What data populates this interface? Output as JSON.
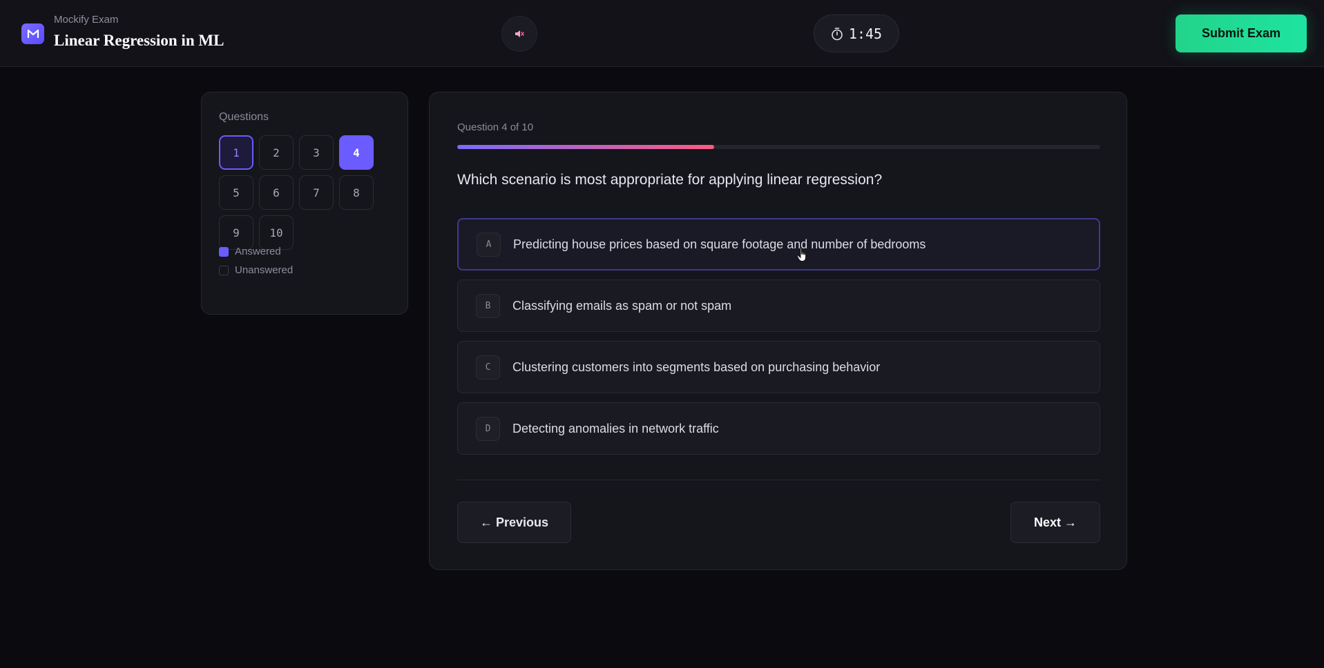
{
  "header": {
    "brand_sub": "Mockify Exam",
    "title": "Linear Regression in ML",
    "timer": "1:45",
    "submit_label": "Submit Exam",
    "icons": {
      "logo": "mockify-logo-icon",
      "sound": "speaker-muted-icon",
      "timer": "stopwatch-icon"
    }
  },
  "navigator": {
    "title": "Questions",
    "questions": [
      {
        "label": "1",
        "state": "current"
      },
      {
        "label": "2",
        "state": "unanswered"
      },
      {
        "label": "3",
        "state": "unanswered"
      },
      {
        "label": "4",
        "state": "answered"
      },
      {
        "label": "5",
        "state": "unanswered"
      },
      {
        "label": "6",
        "state": "unanswered"
      },
      {
        "label": "7",
        "state": "unanswered"
      },
      {
        "label": "8",
        "state": "unanswered"
      },
      {
        "label": "9",
        "state": "unanswered"
      },
      {
        "label": "10",
        "state": "unanswered"
      }
    ],
    "legend": {
      "answered": "Answered",
      "unanswered": "Unanswered"
    }
  },
  "question": {
    "counter": "Question 4 of 10",
    "progress": 0.4,
    "text": "Which scenario is most appropriate for applying linear regression?",
    "options": [
      {
        "letter": "A",
        "text": "Predicting house prices based on square footage and number of bedrooms",
        "selected": true
      },
      {
        "letter": "B",
        "text": "Classifying emails as spam or not spam",
        "selected": false
      },
      {
        "letter": "C",
        "text": "Clustering customers into segments based on purchasing behavior",
        "selected": false
      },
      {
        "letter": "D",
        "text": "Detecting anomalies in network traffic",
        "selected": false
      }
    ]
  },
  "footer": {
    "previous_label": "← Previous",
    "next_label": "Next →"
  },
  "colors": {
    "accent": "#6b5cff",
    "submit": "#22d48a",
    "progress_start": "#7a6bff",
    "progress_end": "#ff5a7e"
  }
}
